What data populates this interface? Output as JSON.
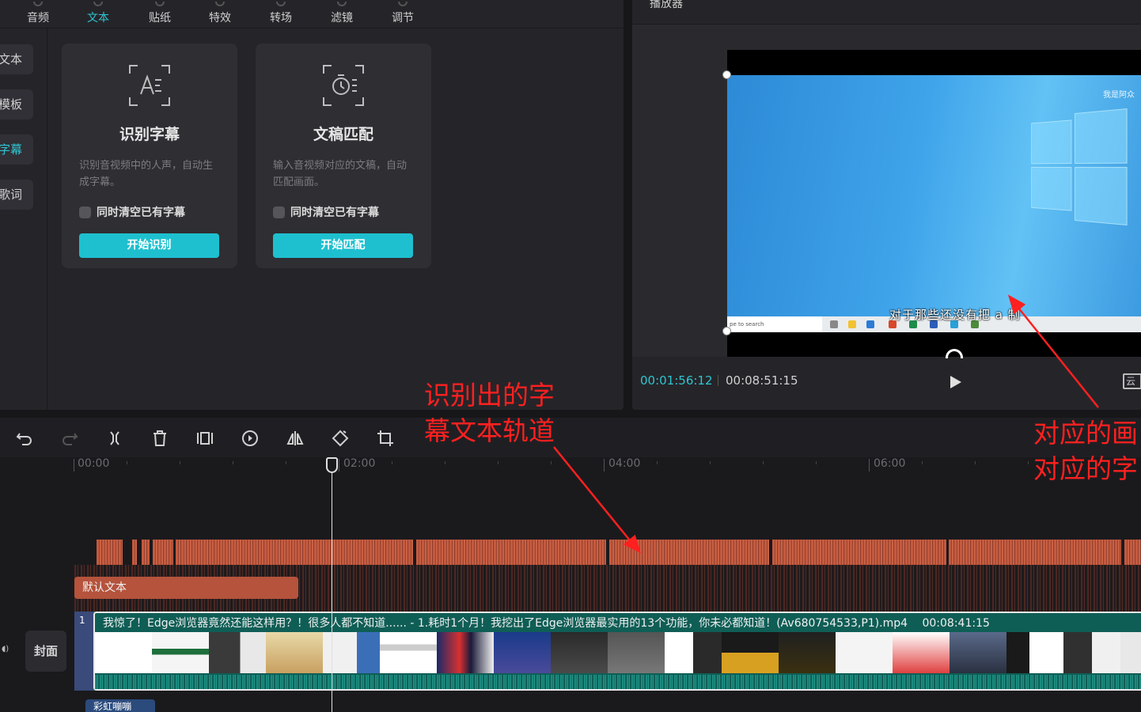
{
  "top_tabs": [
    {
      "label": "音频",
      "active": false
    },
    {
      "label": "文本",
      "active": true
    },
    {
      "label": "贴纸",
      "active": false
    },
    {
      "label": "特效",
      "active": false
    },
    {
      "label": "转场",
      "active": false
    },
    {
      "label": "滤镜",
      "active": false
    },
    {
      "label": "调节",
      "active": false
    }
  ],
  "side_nav": [
    {
      "label": "文本",
      "active": false
    },
    {
      "label": "模板",
      "active": false
    },
    {
      "label": "字幕",
      "active": true
    },
    {
      "label": "歌词",
      "active": false
    }
  ],
  "cards": [
    {
      "title": "识别字幕",
      "desc": "识别音视频中的人声，自动生成字幕。",
      "checkbox": "同时清空已有字幕",
      "button": "开始识别",
      "icon": "speech-recognize-icon"
    },
    {
      "title": "文稿匹配",
      "desc": "输入音视频对应的文稿，自动匹配画面。",
      "checkbox": "同时清空已有字幕",
      "button": "开始匹配",
      "icon": "script-match-icon"
    }
  ],
  "player": {
    "title": "播放器",
    "brand": "我是阿众",
    "subtitle": "对于那些还没有把 a 制",
    "taskbar_search": "pe to search",
    "current_time": "00:01:56:12",
    "total_time": "00:08:51:15",
    "ratio_icon": "云"
  },
  "toolbar": [
    "undo-icon",
    "redo-icon",
    "split-icon",
    "delete-icon",
    "freeze-icon",
    "reverse-icon",
    "mirror-icon",
    "rotate-icon",
    "crop-icon"
  ],
  "ruler": [
    "00:00",
    "02:00",
    "04:00",
    "06:00"
  ],
  "tracks": {
    "default_text": "默认文本",
    "cover": "封面",
    "video_name": "我惊了！Edge浏览器竟然还能这样用？！很多人都不知道...... - 1.耗时1个月！我挖出了Edge浏览器最实用的13个功能，你未必都知道！(Av680754533,P1).mp4",
    "video_duration": "00:08:41:15",
    "next_clip": "彩虹嘣嘣",
    "lead_label": "1"
  },
  "annotations": {
    "left_line1": "识别出的字",
    "left_line2": "幕文本轨道",
    "right_line1": "对应的画",
    "right_line2": "对应的字"
  },
  "colors": {
    "accent": "#1ec0cf",
    "subtitle_clip": "#c45a3e",
    "video_track": "#12695f",
    "annotation": "#ff2020"
  }
}
